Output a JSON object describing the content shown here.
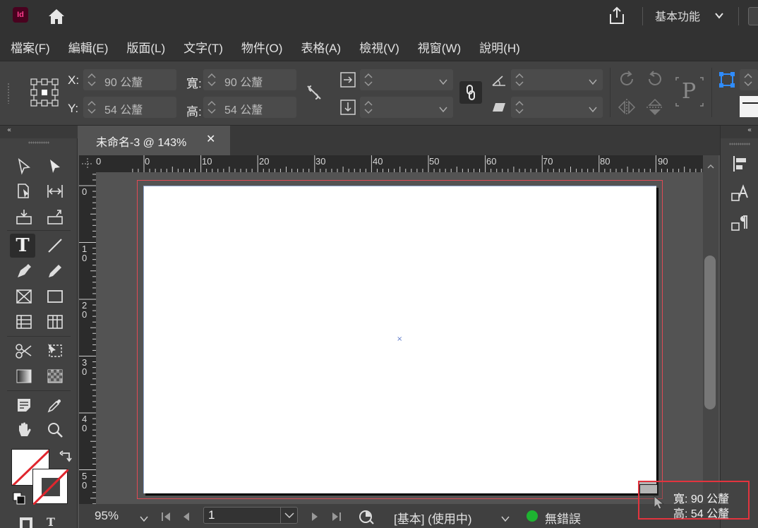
{
  "app": {
    "logo_text": "Id",
    "workspace": "基本功能"
  },
  "menu": [
    "檔案(F)",
    "編輯(E)",
    "版面(L)",
    "文字(T)",
    "物件(O)",
    "表格(A)",
    "檢視(V)",
    "視窗(W)",
    "說明(H)"
  ],
  "control": {
    "x_label": "X:",
    "x_value": "90 公釐",
    "y_label": "Y:",
    "y_value": "54 公釐",
    "w_label": "寬:",
    "w_value": "90 公釐",
    "h_label": "高:",
    "h_value": "54 公釐",
    "p_glyph": "P"
  },
  "document": {
    "tab_title": "未命名-3 @ 143%",
    "close_glyph": "✕",
    "center_marker": "×"
  },
  "ruler": {
    "h_labels": [
      "0",
      "0",
      "10",
      "20",
      "30",
      "40",
      "50",
      "60",
      "70",
      "80",
      "90"
    ],
    "v_labels": [
      "0",
      "1\n0",
      "2\n0",
      "3\n0",
      "4\n0",
      "5\n0"
    ]
  },
  "tools": {
    "type_tool_glyph": "T"
  },
  "status": {
    "zoom": "95%",
    "page": "1",
    "master": "[基本] (使用中)",
    "preflight": "無錯誤"
  },
  "tooltip": {
    "width_text": "寬: 90 公釐",
    "height_text": "高: 54 公釐"
  },
  "colors": {
    "accent_pink": "#ff3d8e",
    "bleed_guide": "#e04a54",
    "ok_green": "#1eb331",
    "highlight_red": "#e2343e"
  }
}
